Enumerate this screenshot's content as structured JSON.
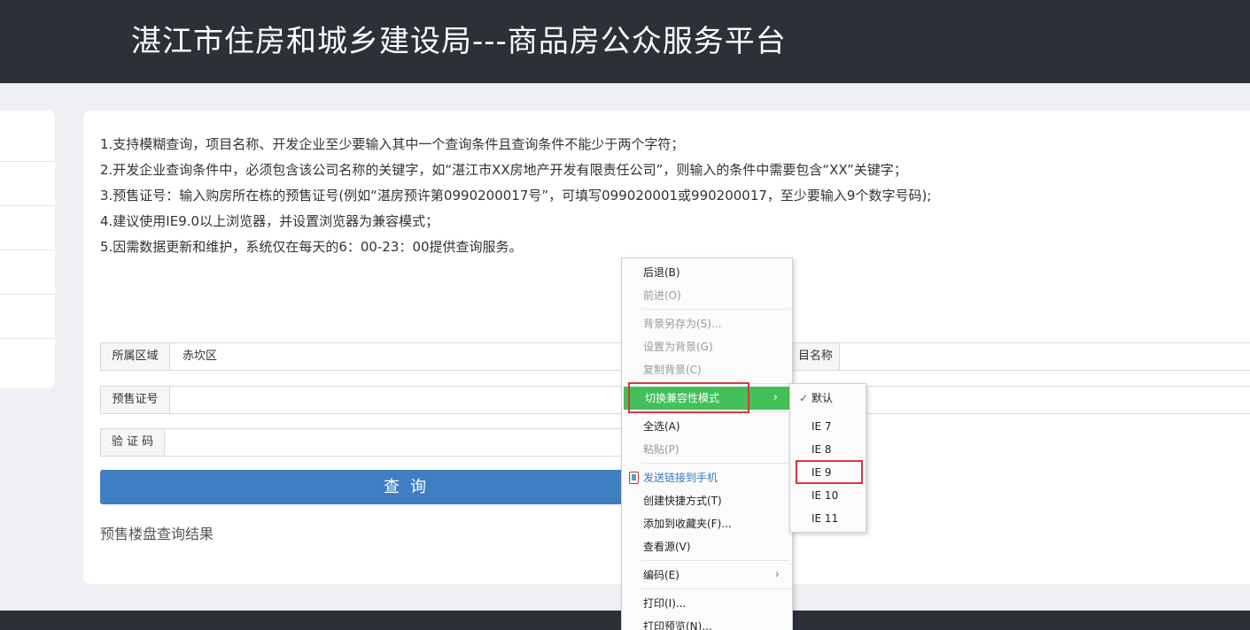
{
  "header": {
    "title": "湛江市住房和城乡建设局---商品房公众服务平台"
  },
  "notes": [
    "1.支持模糊查询，项目名称、开发企业至少要输入其中一个查询条件且查询条件不能少于两个字符；",
    "2.开发企业查询条件中，必须包含该公司名称的关键字，如“湛江市XX房地产开发有限责任公司”，则输入的条件中需要包含“XX”关键字；",
    "3.预售证号：输入购房所在栋的预售证号(例如“湛房预许第0990200017号”，可填写099020001或990200017，至少要输入9个数字号码);",
    "4.建议使用IE9.0以上浏览器，并设置浏览器为兼容模式；",
    "5.因需数据更新和维护，系统仅在每天的6：00-23：00提供查询服务。"
  ],
  "form": {
    "region_label": "所属区域",
    "region_value": "赤坎区",
    "project_label": "目名称",
    "presale_label": "预售证号",
    "captcha_label": "验 证 码"
  },
  "query_button": "查询",
  "result_label": "预售楼盘查询结果",
  "context_menu": {
    "back": "后退(B)",
    "forward": "前进(O)",
    "save_background": "背景另存为(S)...",
    "set_background": "设置为背景(G)",
    "copy_background": "复制背景(C)",
    "compat_mode": "切换兼容性模式",
    "select_all": "全选(A)",
    "paste": "粘贴(P)",
    "send_link": "发送链接到手机",
    "create_shortcut": "创建快捷方式(T)",
    "add_favorite": "添加到收藏夹(F)...",
    "view_source": "查看源(V)",
    "encoding": "编码(E)",
    "print": "打印(I)...",
    "print_preview": "打印预览(N)..."
  },
  "compat_submenu": {
    "default": "默认",
    "ie7": "IE 7",
    "ie8": "IE 8",
    "ie9": "IE 9",
    "ie10": "IE 10",
    "ie11": "IE 11"
  },
  "colors": {
    "header_bg": "#2c3138",
    "highlight": "#43c05a",
    "button": "#3f7fc1",
    "annotation": "#d9363e"
  }
}
